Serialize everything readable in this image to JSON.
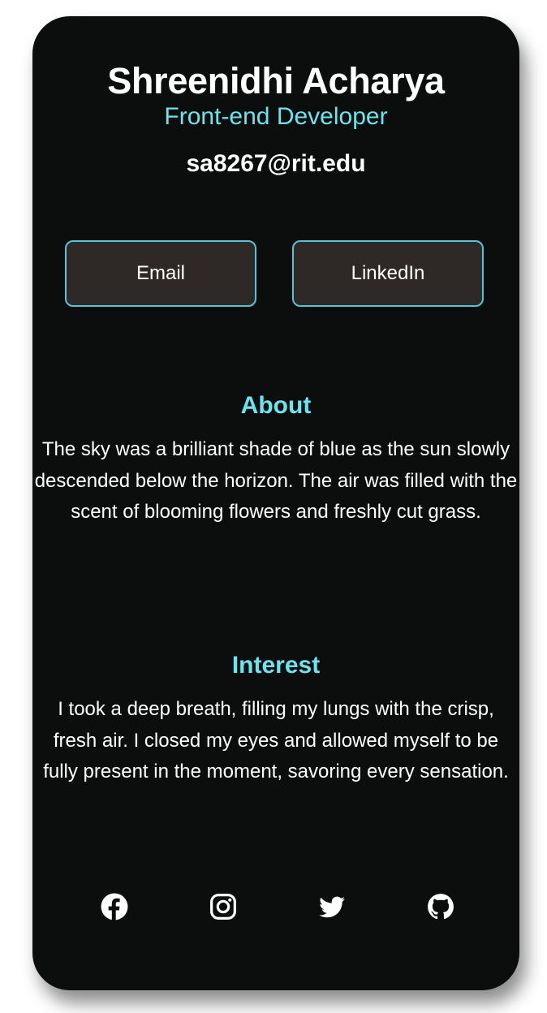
{
  "profile": {
    "name": "Shreenidhi Acharya",
    "role": "Front-end Developer",
    "email": "sa8267@rit.edu"
  },
  "buttons": {
    "email_label": "Email",
    "linkedin_label": "LinkedIn"
  },
  "about": {
    "title": "About",
    "body": "The sky was a brilliant shade of blue as the sun slowly descended below the horizon. The air was filled with the scent of blooming flowers and freshly cut grass."
  },
  "interest": {
    "title": "Interest",
    "body": "I took a deep breath, filling my lungs with the crisp, fresh air. I closed my eyes and allowed myself to be fully present in the moment, savoring every sensation."
  },
  "socials": [
    {
      "icon": "facebook-icon"
    },
    {
      "icon": "instagram-icon"
    },
    {
      "icon": "twitter-icon"
    },
    {
      "icon": "github-icon"
    }
  ],
  "colors": {
    "card_background": "#0c0e0e",
    "accent": "#6ee3ed",
    "button_background": "#2e2926",
    "button_border": "#57c3da",
    "text": "#ffffff"
  }
}
